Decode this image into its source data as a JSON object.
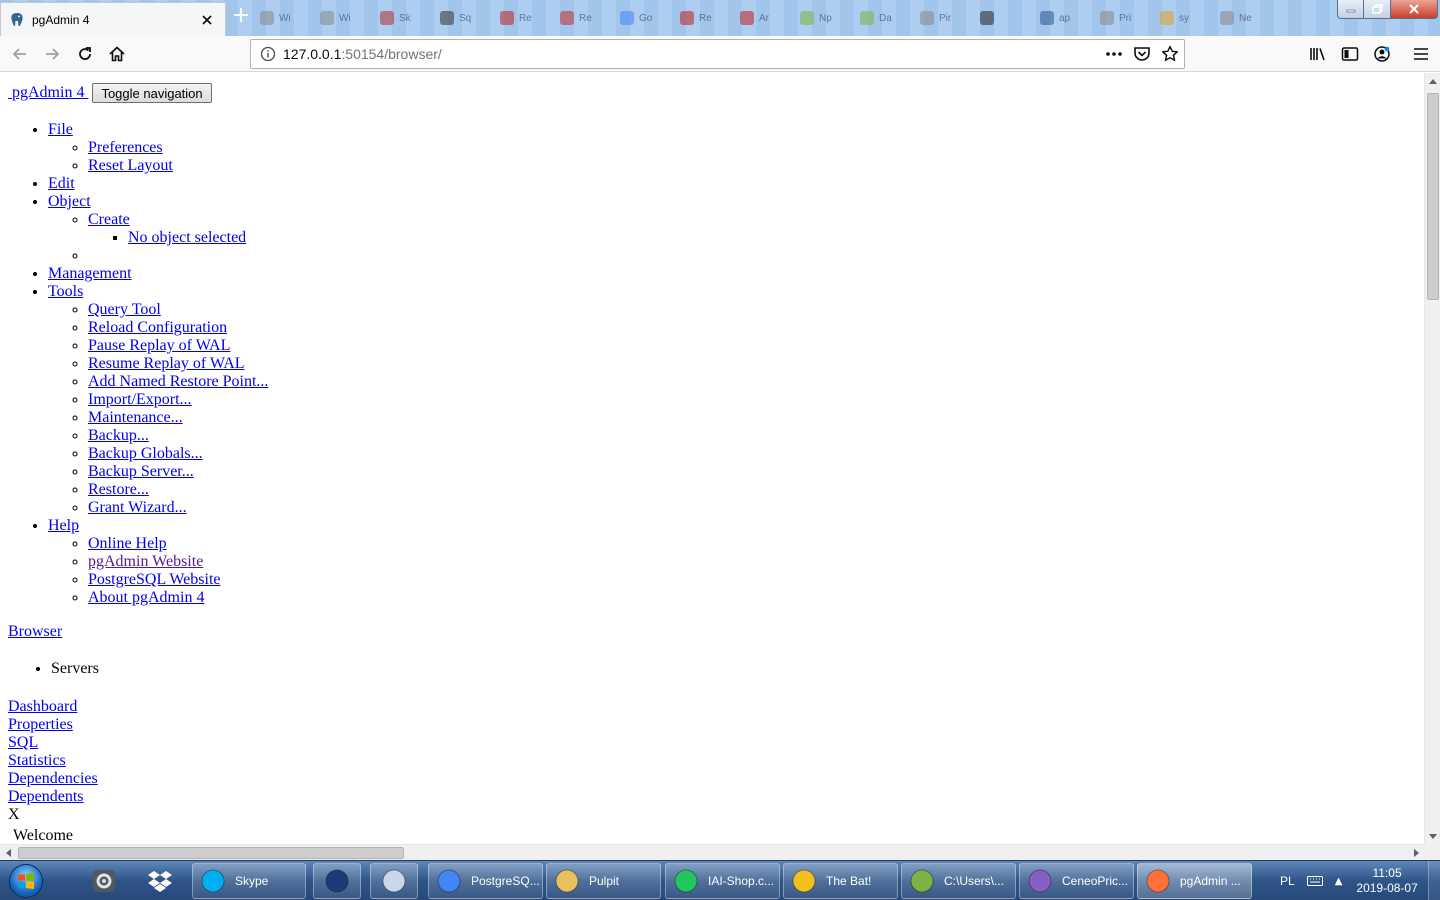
{
  "browser": {
    "active_tab": {
      "title": "pgAdmin 4",
      "icon": "elephant-icon"
    },
    "background_tabs": [
      {
        "label": "Wi",
        "color": "#8a8a8a"
      },
      {
        "label": "Wi",
        "color": "#8a8a8a"
      },
      {
        "label": "Sk",
        "color": "#b03030"
      },
      {
        "label": "Sq",
        "color": "#333333"
      },
      {
        "label": "Re",
        "color": "#c02020"
      },
      {
        "label": "Re",
        "color": "#c03030"
      },
      {
        "label": "Go",
        "color": "#4285f4"
      },
      {
        "label": "Re",
        "color": "#c02020"
      },
      {
        "label": "Ar",
        "color": "#c02020"
      },
      {
        "label": "Np",
        "color": "#7cb342"
      },
      {
        "label": "Da",
        "color": "#7cb342"
      },
      {
        "label": "Pir",
        "color": "#888888"
      },
      {
        "label": "",
        "color": "#222222"
      },
      {
        "label": "ap",
        "color": "#2b5797"
      },
      {
        "label": "Pri",
        "color": "#888888"
      },
      {
        "label": "sy",
        "color": "#e0a020"
      },
      {
        "label": "Ne",
        "color": "#888888"
      }
    ],
    "url": {
      "host": "127.0.0.1",
      "path": ":50154/browser/"
    }
  },
  "page": {
    "brand": "pgAdmin 4",
    "toggle_nav": "Toggle navigation",
    "menu": {
      "file": {
        "label": "File",
        "items": [
          "Preferences",
          "Reset Layout"
        ]
      },
      "edit": {
        "label": "Edit"
      },
      "object": {
        "label": "Object",
        "create": "Create",
        "no_object": "No object selected"
      },
      "management": {
        "label": "Management"
      },
      "tools": {
        "label": "Tools",
        "items": [
          "Query Tool",
          "Reload Configuration",
          "Pause Replay of WAL",
          "Resume Replay of WAL",
          "Add Named Restore Point...",
          "Import/Export...",
          "Maintenance...",
          "Backup...",
          "Backup Globals...",
          "Backup Server...",
          "Restore...",
          "Grant Wizard..."
        ]
      },
      "help": {
        "label": "Help",
        "items": [
          "Online Help",
          "pgAdmin Website",
          "PostgreSQL Website",
          "About pgAdmin 4"
        ]
      }
    },
    "browser_link": "Browser",
    "servers": "Servers",
    "panel_tabs": [
      "Dashboard",
      "Properties",
      "SQL",
      "Statistics",
      "Dependencies",
      "Dependents"
    ],
    "close_x": "X",
    "welcome": "Welcome"
  },
  "taskbar": {
    "pinned": [
      "tools-icon",
      "dropbox-icon"
    ],
    "items": [
      {
        "label": "Skype",
        "icon": "skype-icon",
        "color": "#00aff0"
      },
      {
        "label": "",
        "icon": "xml-icon",
        "color": "#1c3c78"
      },
      {
        "label": "",
        "icon": "calculator-icon",
        "color": "#c8d8e8"
      },
      {
        "label": "PostgreSQ...",
        "icon": "chrome-icon",
        "color": "#4285f4"
      },
      {
        "label": "Pulpit",
        "icon": "folder-icon",
        "color": "#e8c060"
      },
      {
        "label": "IAI-Shop.c...",
        "icon": "datagrip-icon",
        "color": "#22c55e"
      },
      {
        "label": "The Bat!",
        "icon": "bat-icon",
        "color": "#f0c020"
      },
      {
        "label": "C:\\Users\\...",
        "icon": "notepadpp-icon",
        "color": "#7cb342"
      },
      {
        "label": "CeneoPric...",
        "icon": "visual-studio-icon",
        "color": "#865fc5"
      },
      {
        "label": "pgAdmin ...",
        "icon": "firefox-icon",
        "color": "#ff7139"
      }
    ],
    "lang": "PL",
    "time": "11:05",
    "date": "2019-08-07"
  }
}
